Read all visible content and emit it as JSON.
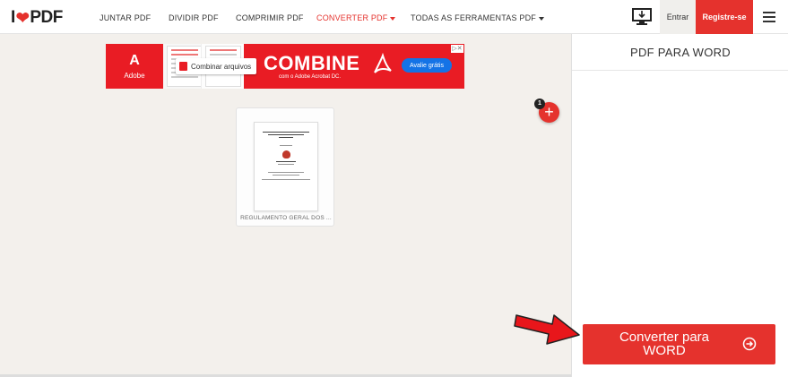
{
  "header": {
    "logo": {
      "left": "I",
      "right": "PDF"
    },
    "nav": [
      {
        "label": "JUNTAR PDF",
        "active": false
      },
      {
        "label": "DIVIDIR PDF",
        "active": false
      },
      {
        "label": "COMPRIMIR PDF",
        "active": false
      },
      {
        "label": "CONVERTER PDF",
        "active": true
      },
      {
        "label": "TODAS AS FERRAMENTAS PDF",
        "active": false
      }
    ],
    "login_label": "Entrar",
    "signup_label": "Registre-se"
  },
  "ad": {
    "brand": "Adobe",
    "chip_label": "Combinar arquivos",
    "headline": "COMBINE",
    "subline": "com o Adobe Acrobat DC.",
    "cta": "Avalie grátis"
  },
  "file": {
    "name": "REGULAMENTO GERAL DOS ..."
  },
  "add_button": {
    "badge": "1",
    "symbol": "+"
  },
  "sidebar": {
    "title": "PDF PARA WORD",
    "convert_label": "Converter para WORD"
  },
  "colors": {
    "brand_red": "#e5322d",
    "ad_blue": "#1473e6",
    "background": "#f3f0ec"
  }
}
